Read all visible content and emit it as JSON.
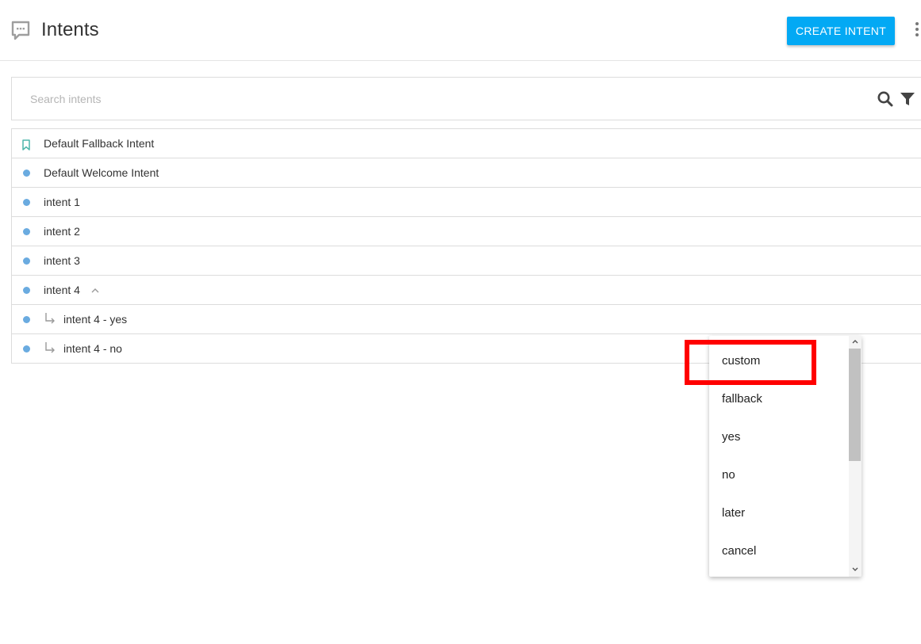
{
  "header": {
    "title": "Intents",
    "icon": "chat-bubble-icon",
    "create_button_label": "CREATE INTENT",
    "more_icon": "more-vert-icon"
  },
  "search": {
    "placeholder": "Search intents",
    "value": "",
    "search_icon": "search-icon",
    "filter_icon": "filter-icon"
  },
  "intents": [
    {
      "label": "Default Fallback Intent",
      "marker": "bookmark-icon"
    },
    {
      "label": "Default Welcome Intent",
      "marker": "dot"
    },
    {
      "label": "intent 1",
      "marker": "dot"
    },
    {
      "label": "intent 2",
      "marker": "dot"
    },
    {
      "label": "intent 3",
      "marker": "dot"
    },
    {
      "label": "intent 4",
      "marker": "dot",
      "expanded": true
    },
    {
      "label": "intent 4 - yes",
      "marker": "dot",
      "child": true
    },
    {
      "label": "intent 4 - no",
      "marker": "dot",
      "child": true
    }
  ],
  "dropdown": {
    "options": [
      "custom",
      "fallback",
      "yes",
      "no",
      "later",
      "cancel"
    ],
    "highlighted": "custom"
  },
  "colors": {
    "accent": "#03a9f4",
    "dot": "#6aabe0",
    "bookmark": "#4db6ac",
    "highlight": "#ff0000"
  }
}
